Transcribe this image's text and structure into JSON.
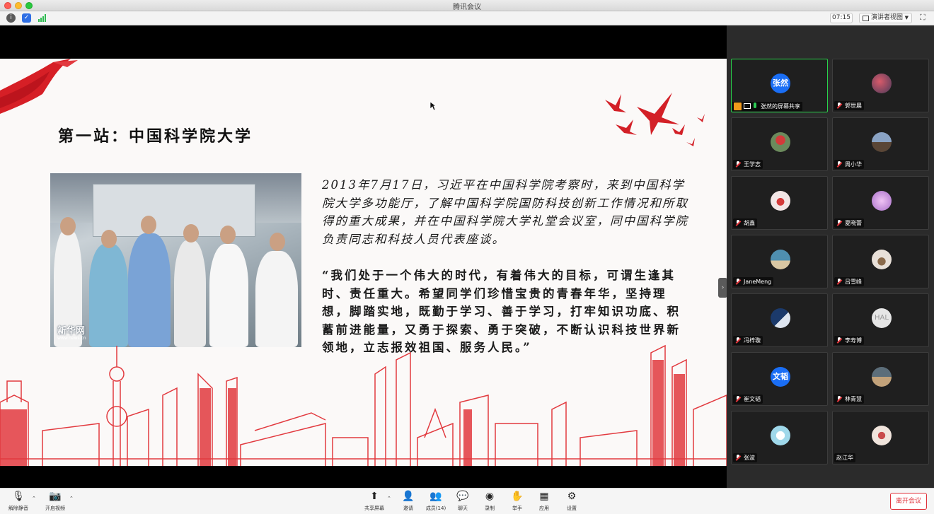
{
  "window": {
    "title": "腾讯会议"
  },
  "infobar": {
    "timer": "07:15",
    "view_mode": "演讲者视图"
  },
  "slide": {
    "title": "第一站：中国科学院大学",
    "photo_watermark": "新华网",
    "photo_watermark_url": "www.news.cn",
    "paragraph1": "2013年7月17日，习近平在中国科学院考察时，来到中国科学院大学多功能厅，了解中国科学院国防科技创新工作情况和所取得的重大成果，并在中国科学院大学礼堂会议室，同中国科学院负责同志和科技人员代表座谈。",
    "paragraph2": "“我们处于一个伟大的时代，有着伟大的目标，可谓生逢其时、责任重大。希望同学们珍惜宝贵的青春年华，坚持理想，脚踏实地，既勤于学习、善于学习，打牢知识功底、积蓄前进能量，又勇于探索、勇于突破，不断认识科技世界新领地，立志报效祖国、服务人民。”"
  },
  "participants": [
    {
      "name": "张然的屏幕共享",
      "avatar_text": "张然",
      "avatar_color": "#1a6ef5",
      "active": true
    },
    {
      "name": "郭世晨",
      "avatar_text": "",
      "avatar_color": "#4a3a5a"
    },
    {
      "name": "王学志",
      "avatar_text": "",
      "avatar_color": "#6b8a5c"
    },
    {
      "name": "周小华",
      "avatar_text": "",
      "avatar_color": "#8aa3c4"
    },
    {
      "name": "胡鑫",
      "avatar_text": "",
      "avatar_color": "#f2e6e6"
    },
    {
      "name": "夏晓蕾",
      "avatar_text": "",
      "avatar_color": "#a86fc9"
    },
    {
      "name": "JaneMeng",
      "avatar_text": "",
      "avatar_color": "#4f8fb0"
    },
    {
      "name": "吕雪峰",
      "avatar_text": "",
      "avatar_color": "#e8e0d8"
    },
    {
      "name": "冯梓璇",
      "avatar_text": "",
      "avatar_color": "#1b3a6b"
    },
    {
      "name": "李寿博",
      "avatar_text": "HAL",
      "avatar_color": "#e6e6e6"
    },
    {
      "name": "崔文韬",
      "avatar_text": "文韬",
      "avatar_color": "#1a6ef5"
    },
    {
      "name": "林青慧",
      "avatar_text": "",
      "avatar_color": "#5c6e7a"
    },
    {
      "name": "张波",
      "avatar_text": "",
      "avatar_color": "#d8eef5"
    },
    {
      "name": "赵江华",
      "avatar_text": "",
      "avatar_color": "#f0e4dc"
    }
  ],
  "toolbar": {
    "mute": "解除静音",
    "video": "开启视频",
    "share": "共享屏幕",
    "invite": "邀请",
    "members": "成员(14)",
    "chat": "聊天",
    "record": "录制",
    "raise_hand": "举手",
    "apps": "应用",
    "settings": "设置",
    "leave": "离开会议"
  }
}
